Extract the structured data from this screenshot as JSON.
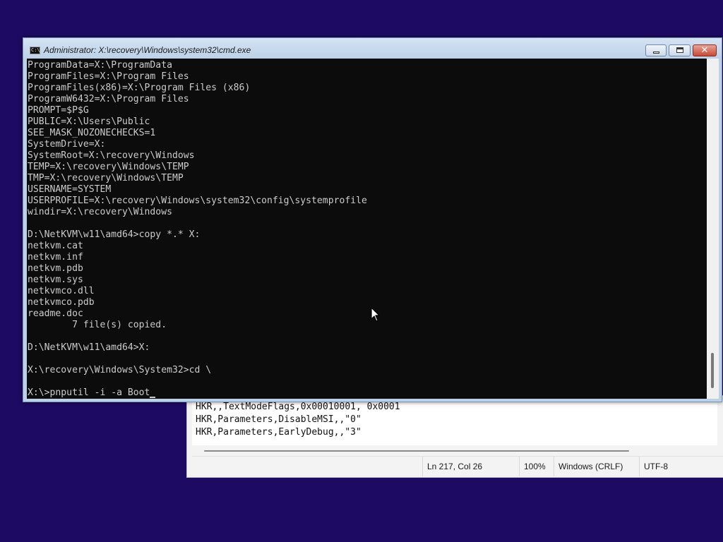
{
  "cmd_window": {
    "title": "Administrator: X:\\recovery\\Windows\\system32\\cmd.exe",
    "icon_label": "C:\\",
    "close_glyph": "✕",
    "lines": [
      "ProgramData=X:\\ProgramData",
      "ProgramFiles=X:\\Program Files",
      "ProgramFiles(x86)=X:\\Program Files (x86)",
      "ProgramW6432=X:\\Program Files",
      "PROMPT=$P$G",
      "PUBLIC=X:\\Users\\Public",
      "SEE_MASK_NOZONECHECKS=1",
      "SystemDrive=X:",
      "SystemRoot=X:\\recovery\\Windows",
      "TEMP=X:\\recovery\\Windows\\TEMP",
      "TMP=X:\\recovery\\Windows\\TEMP",
      "USERNAME=SYSTEM",
      "USERPROFILE=X:\\recovery\\Windows\\system32\\config\\systemprofile",
      "windir=X:\\recovery\\Windows",
      "",
      "D:\\NetKVM\\w11\\amd64>copy *.* X:",
      "netkvm.cat",
      "netkvm.inf",
      "netkvm.pdb",
      "netkvm.sys",
      "netkvmco.dll",
      "netkvmco.pdb",
      "readme.doc",
      "        7 file(s) copied.",
      "",
      "D:\\NetKVM\\w11\\amd64>X:",
      "",
      "X:\\recovery\\Windows\\System32>cd \\",
      ""
    ],
    "current_command": "X:\\>pnputil -i -a Boot"
  },
  "notepad_window": {
    "lines": [
      "HKR,,TextModeFlags,0x00010001, 0x0001",
      "HKR,Parameters,DisableMSI,,\"0\"",
      "HKR,Parameters,EarlyDebug,,\"3\""
    ],
    "status": {
      "position": "Ln 217, Col 26",
      "zoom": "100%",
      "line_ending": "Windows (CRLF)",
      "encoding": "UTF-8"
    }
  }
}
